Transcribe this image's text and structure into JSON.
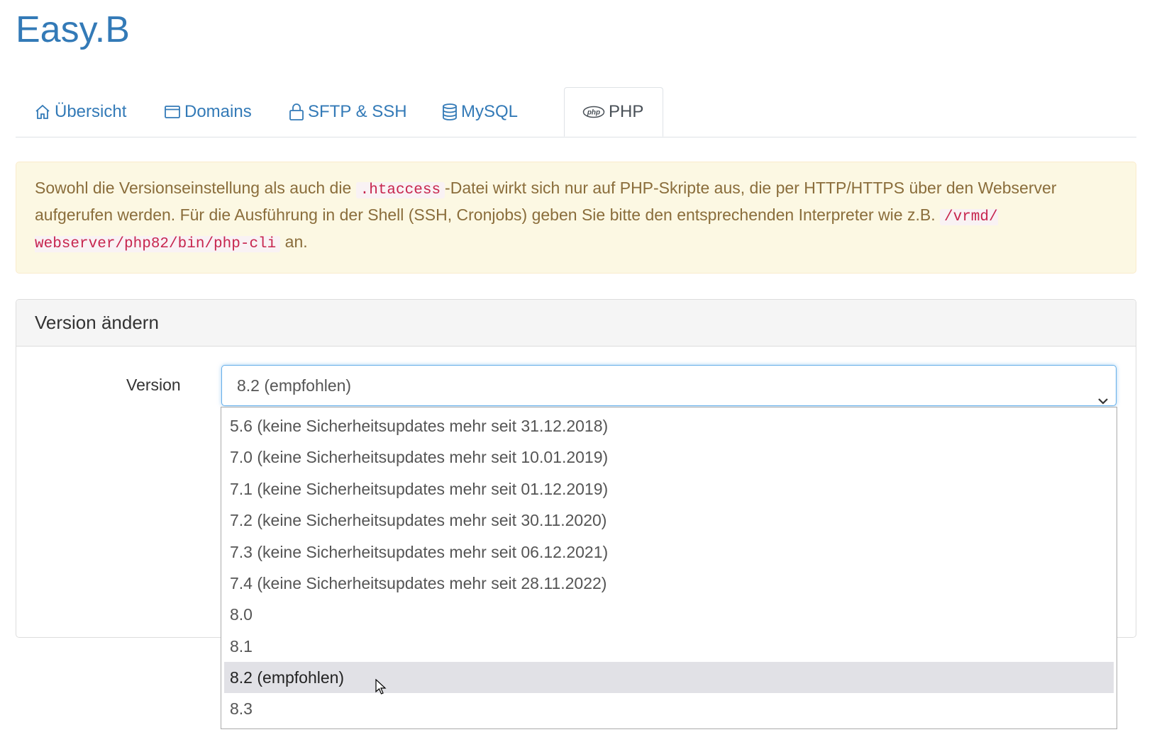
{
  "brand": "Easy.B",
  "tabs": [
    {
      "label": "Übersicht",
      "icon": "home-icon"
    },
    {
      "label": "Domains",
      "icon": "window-icon"
    },
    {
      "label": "SFTP & SSH",
      "icon": "lock-icon"
    },
    {
      "label": "MySQL",
      "icon": "database-icon"
    },
    {
      "label": "PHP",
      "icon": "php-icon",
      "active": true
    }
  ],
  "alert": {
    "t1": "Sowohl die Versionseinstellung als auch die",
    "code1": ".htaccess",
    "t2": "-Datei wirkt sich nur auf PHP-Skripte aus, die per HTTP/HTTPS über den Webserver aufgerufen werden. Für die Ausführung in der Shell (SSH, Cronjobs) geben Sie bitte den entsprechenden Interpreter wie z.B.",
    "code2": "/vrmd/ webserver/php82/bin/php-cli",
    "t3": "an."
  },
  "card": {
    "title": "Version ändern",
    "version_label": "Version",
    "selected": "8.2 (empfohlen)"
  },
  "options": [
    "5.6 (keine Sicherheitsupdates mehr seit 31.12.2018)",
    "7.0 (keine Sicherheitsupdates mehr seit 10.01.2019)",
    "7.1 (keine Sicherheitsupdates mehr seit 01.12.2019)",
    "7.2 (keine Sicherheitsupdates mehr seit 30.11.2020)",
    "7.3 (keine Sicherheitsupdates mehr seit 06.12.2021)",
    "7.4 (keine Sicherheitsupdates mehr seit 28.11.2022)",
    "8.0",
    "8.1",
    "8.2 (empfohlen)",
    "8.3"
  ],
  "colors": {
    "link": "#337ab7",
    "alert_bg": "#fcf8e3",
    "alert_text": "#8a6d3b",
    "code": "#c7254e",
    "focus": "#66afe9"
  }
}
